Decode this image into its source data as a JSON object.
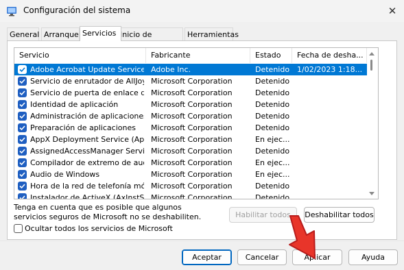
{
  "window": {
    "title": "Configuración del sistema",
    "close_glyph": "✕"
  },
  "tabs": [
    {
      "label": "General"
    },
    {
      "label": "Arranque"
    },
    {
      "label": "Servicios"
    },
    {
      "label": "Inicio de Windows"
    },
    {
      "label": "Herramientas"
    }
  ],
  "columns": {
    "service": "Servicio",
    "manufacturer": "Fabricante",
    "status": "Estado",
    "disabled_date": "Fecha de desha..."
  },
  "services": [
    {
      "name": "Adobe Acrobat Update Service",
      "manufacturer": "Adobe Inc.",
      "status": "Detenido",
      "date": "1/02/2023 1:18...",
      "checked": true,
      "selected": true
    },
    {
      "name": "Servicio de enrutador de AllJoyn",
      "manufacturer": "Microsoft Corporation",
      "status": "Detenido",
      "date": "",
      "checked": true
    },
    {
      "name": "Servicio de puerta de enlace de ...",
      "manufacturer": "Microsoft Corporation",
      "status": "Detenido",
      "date": "",
      "checked": true
    },
    {
      "name": "Identidad de aplicación",
      "manufacturer": "Microsoft Corporation",
      "status": "Detenido",
      "date": "",
      "checked": true
    },
    {
      "name": "Administración de aplicaciones",
      "manufacturer": "Microsoft Corporation",
      "status": "Detenido",
      "date": "",
      "checked": true
    },
    {
      "name": "Preparación de aplicaciones",
      "manufacturer": "Microsoft Corporation",
      "status": "Detenido",
      "date": "",
      "checked": true
    },
    {
      "name": "AppX Deployment Service (AppX...",
      "manufacturer": "Microsoft Corporation",
      "status": "En ejec...",
      "date": "",
      "checked": true
    },
    {
      "name": "AssignedAccessManager Service",
      "manufacturer": "Microsoft Corporation",
      "status": "Detenido",
      "date": "",
      "checked": true
    },
    {
      "name": "Compilador de extremo de audio...",
      "manufacturer": "Microsoft Corporation",
      "status": "En ejec...",
      "date": "",
      "checked": true
    },
    {
      "name": "Audio de Windows",
      "manufacturer": "Microsoft Corporation",
      "status": "En ejec...",
      "date": "",
      "checked": true
    },
    {
      "name": "Hora de la red de telefonía móvil",
      "manufacturer": "Microsoft Corporation",
      "status": "Detenido",
      "date": "",
      "checked": true
    },
    {
      "name": "Instalador de ActiveX (AxInstSV)",
      "manufacturer": "Microsoft Corporation",
      "status": "Detenido",
      "date": "",
      "checked": true
    }
  ],
  "note": "Tenga en cuenta que es posible que algunos servicios seguros de Microsoft no se deshabiliten.",
  "buttons": {
    "enable_all": "Habilitar todos",
    "disable_all": "Deshabilitar todos",
    "ok": "Aceptar",
    "cancel": "Cancelar",
    "apply": "Aplicar",
    "help": "Ayuda"
  },
  "hide_ms_label": "Ocultar todos los servicios de Microsoft",
  "hide_ms_checked": false,
  "colors": {
    "selection": "#0078d4",
    "checkbox": "#1f5fc1",
    "annotation_arrow": "#e8352a"
  },
  "icons": {
    "app": "system-config-icon",
    "check": "check-icon",
    "arrow": "red-pointer-arrow-icon"
  }
}
